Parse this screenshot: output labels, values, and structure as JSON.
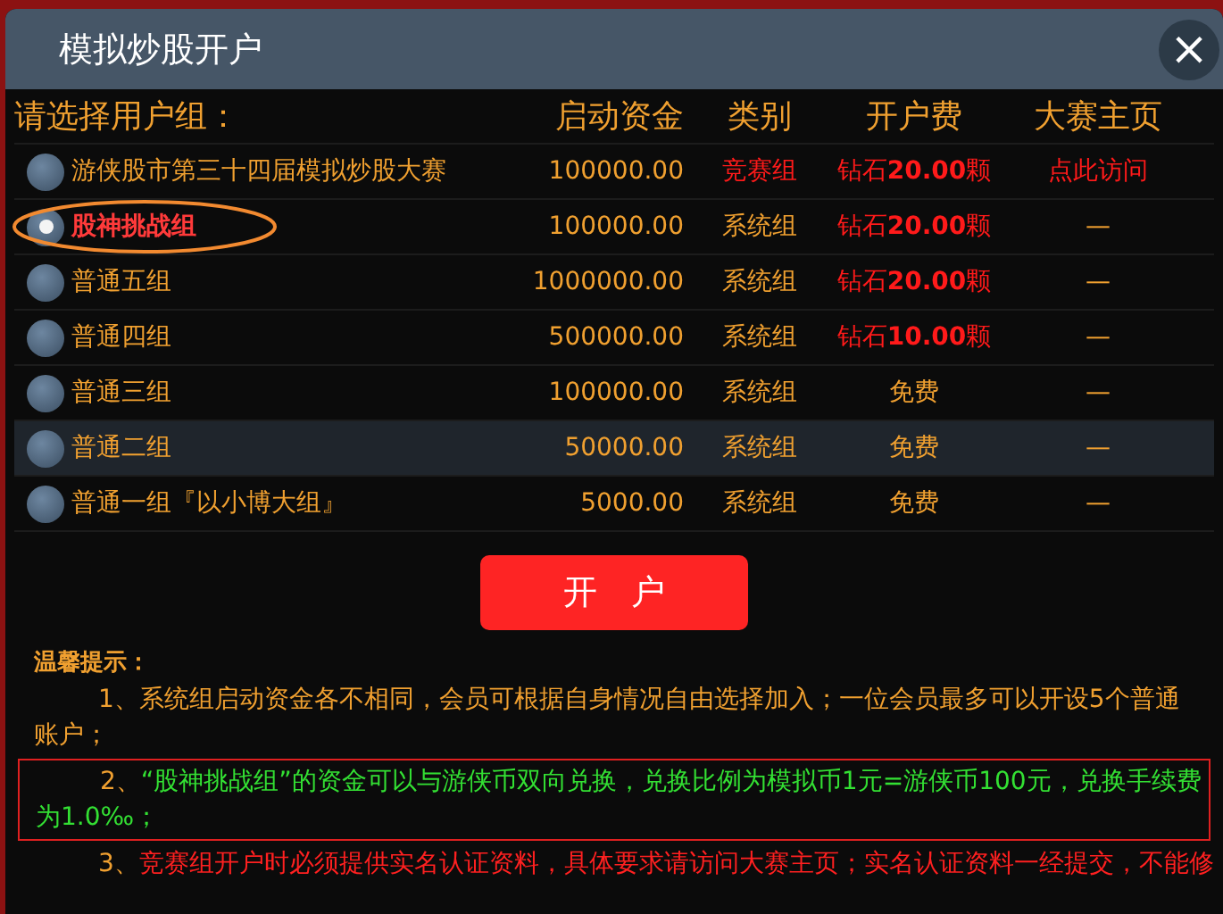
{
  "dialog": {
    "title": "模拟炒股开户",
    "close": "×"
  },
  "table": {
    "columns": [
      "请选择用户组：",
      "启动资金",
      "类别",
      "开户费",
      "大赛主页"
    ],
    "rows": [
      {
        "name": "游侠股市第三十四届模拟炒股大赛",
        "capital": "100000.00",
        "category": "竞赛组",
        "kind": "contest",
        "fee": {
          "text": "钻石**20.00**颗",
          "kind": "diamond"
        },
        "homepage": "点此访问",
        "selected": false,
        "highlighted": false
      },
      {
        "name": "股神挑战组",
        "capital": "100000.00",
        "category": "系统组",
        "kind": "system",
        "fee": {
          "text": "钻石**20.00**颗",
          "kind": "diamond"
        },
        "homepage": "—",
        "selected": true,
        "highlighted": false
      },
      {
        "name": "普通五组",
        "capital": "1000000.00",
        "category": "系统组",
        "kind": "system",
        "fee": {
          "text": "钻石**20.00**颗",
          "kind": "diamond"
        },
        "homepage": "—",
        "selected": false,
        "highlighted": false
      },
      {
        "name": "普通四组",
        "capital": "500000.00",
        "category": "系统组",
        "kind": "system",
        "fee": {
          "text": "钻石**10.00**颗",
          "kind": "diamond"
        },
        "homepage": "—",
        "selected": false,
        "highlighted": false
      },
      {
        "name": "普通三组",
        "capital": "100000.00",
        "category": "系统组",
        "kind": "system",
        "fee": {
          "text": "免费",
          "kind": "free"
        },
        "homepage": "—",
        "selected": false,
        "highlighted": false
      },
      {
        "name": "普通二组",
        "capital": "50000.00",
        "category": "系统组",
        "kind": "system",
        "fee": {
          "text": "免费",
          "kind": "free"
        },
        "homepage": "—",
        "selected": false,
        "highlighted": true
      },
      {
        "name": "普通一组『以小博大组』",
        "capital": "5000.00",
        "category": "系统组",
        "kind": "system",
        "fee": {
          "text": "免费",
          "kind": "free"
        },
        "homepage": "—",
        "selected": false,
        "highlighted": false
      }
    ]
  },
  "open_button": "开　户",
  "notes": {
    "heading": "温馨提示：",
    "items": [
      {
        "number": "1、",
        "text": "系统组启动资金各不相同，会员可根据自身情况自由选择加入；一位会员最多可以开设5个普通账户；",
        "kind": "normal"
      },
      {
        "number": "2、",
        "text": "“股神挑战组”的资金可以与游侠币双向兑换，兑换比例为模拟币1元=游侠币100元，兑换手续费为1.0‰；",
        "kind": "boxed"
      },
      {
        "number": "3、",
        "text": "竞赛组开户时必须提供实名认证资料，具体要求请访问大赛主页；实名认证资料一经提交，不能修",
        "kind": "warning"
      }
    ]
  }
}
